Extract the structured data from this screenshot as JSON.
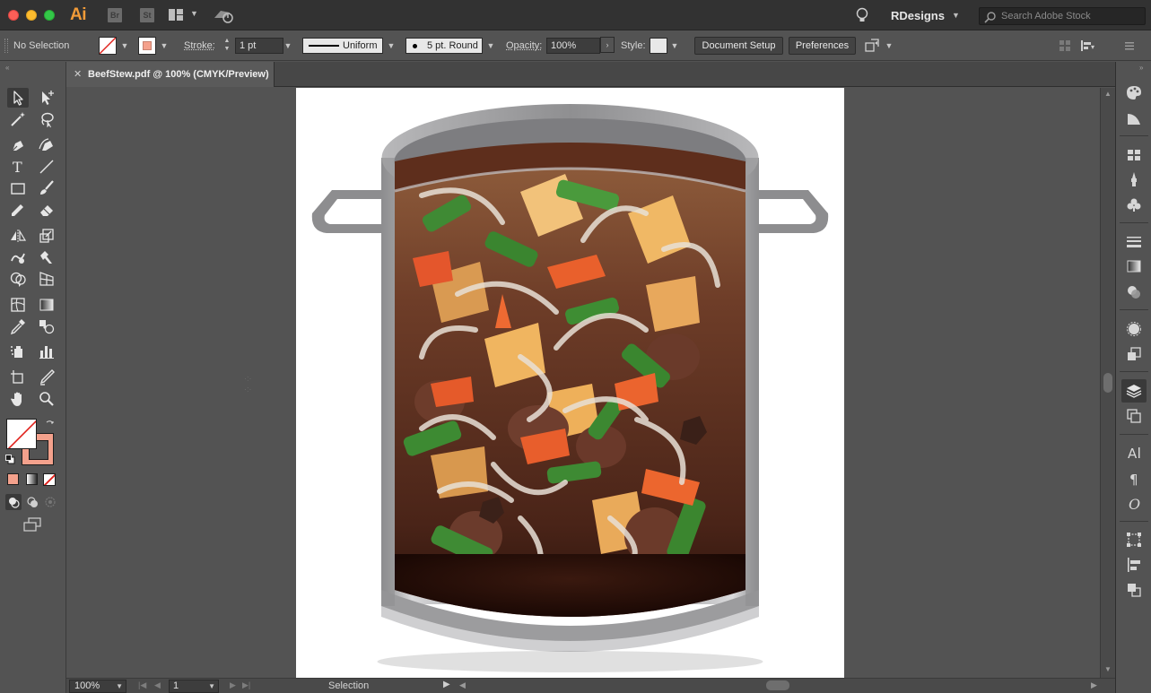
{
  "app": {
    "logo": "Ai",
    "badges": [
      "Br",
      "St"
    ]
  },
  "titlebar": {
    "workspace": "RDesigns",
    "stock_search_placeholder": "Search Adobe Stock"
  },
  "controlbar": {
    "selection_label": "No Selection",
    "stroke_label": "Stroke:",
    "stroke_weight": "1 pt",
    "profile": "Uniform",
    "brush": "5 pt. Round",
    "opacity_label": "Opacity:",
    "opacity_value": "100%",
    "style_label": "Style:",
    "document_setup": "Document Setup",
    "preferences": "Preferences"
  },
  "document_tab": {
    "title": "BeefStew.pdf @ 100% (CMYK/Preview)"
  },
  "statusbar": {
    "zoom": "100%",
    "artboard": "1",
    "tool": "Selection"
  },
  "colors": {
    "fill": "#ffffff",
    "stroke": "#f4a18c",
    "accent": "#f29b38",
    "canvas": "#535353"
  },
  "toolbar_icons": [
    "selection-tool-icon",
    "direct-selection-tool-icon",
    "magic-wand-tool-icon",
    "lasso-tool-icon",
    "pen-tool-icon",
    "curvature-tool-icon",
    "type-tool-icon",
    "line-segment-tool-icon",
    "rectangle-tool-icon",
    "paintbrush-tool-icon",
    "shaper-tool-icon",
    "eraser-tool-icon",
    "reflect-tool-icon",
    "scale-tool-icon",
    "warp-tool-icon",
    "puppet-warp-tool-icon",
    "shape-builder-tool-icon",
    "perspective-grid-tool-icon",
    "mesh-tool-icon",
    "gradient-tool-icon",
    "eyedropper-tool-icon",
    "blend-tool-icon",
    "symbol-sprayer-tool-icon",
    "column-graph-tool-icon",
    "artboard-tool-icon",
    "slice-tool-icon",
    "hand-tool-icon",
    "zoom-tool-icon"
  ],
  "dock_icons": [
    "color-panel-icon",
    "color-guide-icon",
    "swatches-icon",
    "brushes-icon",
    "symbols-icon",
    "stroke-panel-icon",
    "gradient-panel-icon",
    "transparency-icon",
    "appearance-icon",
    "graphic-styles-icon",
    "layers-icon",
    "artboards-icon",
    "character-icon",
    "paragraph-icon",
    "opentype-icon",
    "transform-icon",
    "align-icon",
    "pathfinder-icon"
  ]
}
